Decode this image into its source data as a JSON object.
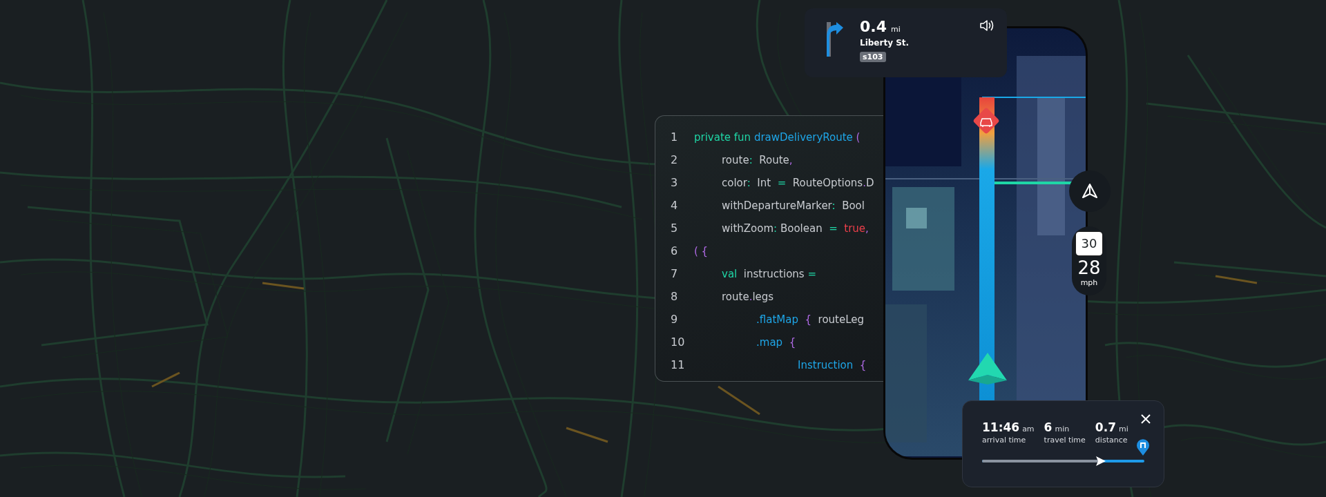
{
  "instruction": {
    "distance": "0.4",
    "unit": "mi",
    "street": "Liberty St.",
    "exit": "s103"
  },
  "code": {
    "lines": [
      {
        "number": "1",
        "kind": "decl",
        "tokens": [
          {
            "kind": "keyword",
            "text": "private fun "
          },
          {
            "kind": "function",
            "text": "drawDeliveryRoute "
          },
          {
            "kind": "punct",
            "text": "("
          }
        ]
      },
      {
        "number": "2",
        "kind": "stmt",
        "tokens": [
          {
            "kind": "plain",
            "text": "route"
          },
          {
            "kind": "operator",
            "text": ":"
          },
          {
            "kind": "plain",
            "text": "  Route"
          },
          {
            "kind": "punct",
            "text": ","
          }
        ]
      },
      {
        "number": "3",
        "kind": "stmt",
        "tokens": [
          {
            "kind": "plain",
            "text": "color"
          },
          {
            "kind": "operator",
            "text": ":"
          },
          {
            "kind": "plain",
            "text": "  Int  "
          },
          {
            "kind": "operator",
            "text": "="
          },
          {
            "kind": "plain",
            "text": "  RouteOptions"
          },
          {
            "kind": "punct",
            "text": "."
          },
          {
            "kind": "plain",
            "text": "D"
          }
        ]
      },
      {
        "number": "4",
        "kind": "stmt",
        "tokens": [
          {
            "kind": "plain",
            "text": "withDepartureMarker"
          },
          {
            "kind": "operator",
            "text": ":"
          },
          {
            "kind": "plain",
            "text": "  Bool"
          }
        ]
      },
      {
        "number": "5",
        "kind": "stmt",
        "tokens": [
          {
            "kind": "plain",
            "text": "withZoom"
          },
          {
            "kind": "operator",
            "text": ":"
          },
          {
            "kind": "plain",
            "text": " Boolean  "
          },
          {
            "kind": "operator",
            "text": "="
          },
          {
            "kind": "literal",
            "text": "  true"
          },
          {
            "kind": "punct",
            "text": ","
          }
        ]
      },
      {
        "number": "6",
        "kind": "decl",
        "tokens": [
          {
            "kind": "punct",
            "text": "( {"
          }
        ]
      },
      {
        "number": "7",
        "kind": "stmt",
        "tokens": [
          {
            "kind": "keyword",
            "text": "val"
          },
          {
            "kind": "plain",
            "text": "  instructions "
          },
          {
            "kind": "operator",
            "text": "="
          }
        ]
      },
      {
        "number": "8",
        "kind": "stmt",
        "tokens": [
          {
            "kind": "plain",
            "text": "route"
          },
          {
            "kind": "punct",
            "text": "."
          },
          {
            "kind": "plain",
            "text": "legs"
          }
        ]
      },
      {
        "number": "9",
        "kind": "chain",
        "tokens": [
          {
            "kind": "function",
            "text": ".flatMap  "
          },
          {
            "kind": "punct",
            "text": "{"
          },
          {
            "kind": "plain",
            "text": "  routeLeg"
          }
        ]
      },
      {
        "number": "10",
        "kind": "chain",
        "tokens": [
          {
            "kind": "function",
            "text": ".map  "
          },
          {
            "kind": "punct",
            "text": "{"
          }
        ]
      },
      {
        "number": "11",
        "kind": "nested",
        "tokens": [
          {
            "kind": "function",
            "text": "Instruction  "
          },
          {
            "kind": "punct",
            "text": "{"
          }
        ]
      }
    ]
  },
  "speed": {
    "limit": "30",
    "current": "28",
    "unit": "mph"
  },
  "trip": {
    "stats": [
      {
        "value": "11:46",
        "unit": "am",
        "label": "arrival time"
      },
      {
        "value": "6",
        "unit": "min",
        "label": "travel time"
      },
      {
        "value": "0.7",
        "unit": "mi",
        "label": "distance"
      }
    ],
    "progress": {
      "level": 0.73
    }
  }
}
